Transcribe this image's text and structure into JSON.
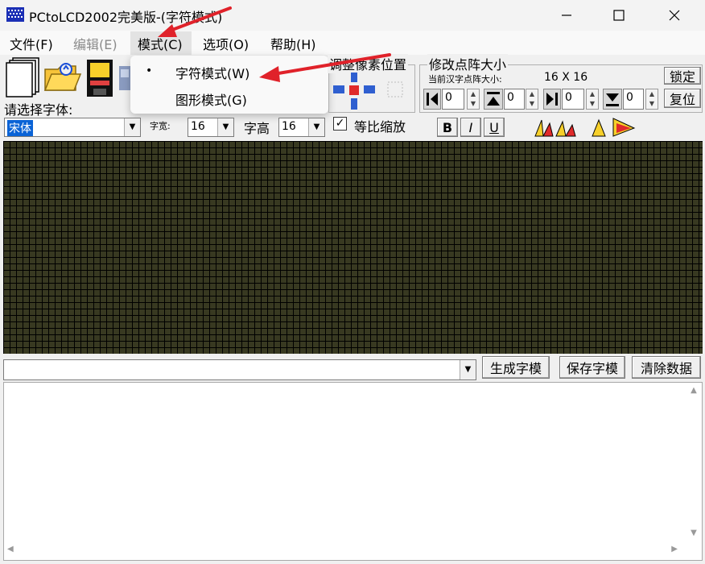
{
  "window": {
    "title": "PCtoLCD2002完美版-(字符模式)"
  },
  "menu": {
    "file": "文件(F)",
    "edit": "编辑(E)",
    "mode": "模式(C)",
    "options": "选项(O)",
    "help": "帮助(H)"
  },
  "mode_menu": {
    "items": [
      {
        "label": "字符模式(W)",
        "checked": true
      },
      {
        "label": "图形模式(G)",
        "checked": false
      }
    ]
  },
  "font_select": {
    "label": "请选择字体:",
    "value": "宋体"
  },
  "font_width": {
    "label": "字宽:",
    "value": "16"
  },
  "font_height": {
    "label": "字高",
    "value": "16"
  },
  "proportional": {
    "label": "等比缩放",
    "checked": true
  },
  "style_buttons": {
    "bold": "B",
    "italic": "I",
    "underline": "U"
  },
  "pixel_group": {
    "title": "调整像素位置"
  },
  "matrix_group": {
    "title": "修改点阵大小",
    "current_label": "当前汉字点阵大小:",
    "current_value": "16 X 16",
    "lock_button": "锁定",
    "reset_button": "复位",
    "spinners": [
      "0",
      "0",
      "0",
      "0"
    ]
  },
  "actions": {
    "generate": "生成字模",
    "save": "保存字模",
    "clear": "清除数据"
  },
  "colors": {
    "grid_cell": "#383921",
    "grid_line": "#000000",
    "arrow": "#e0222a"
  }
}
